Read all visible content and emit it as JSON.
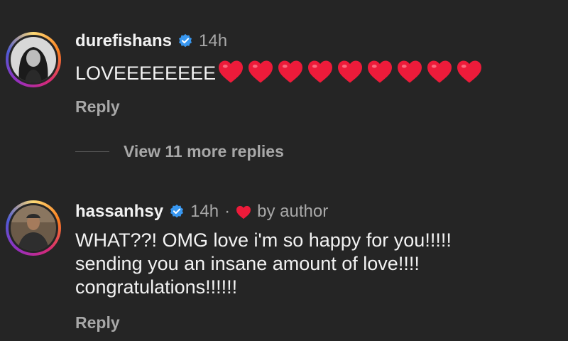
{
  "comments": [
    {
      "username": "durefishans",
      "time": "14h",
      "text": "LOVEEEEEEEE",
      "heart_count": 9,
      "reply_label": "Reply",
      "avatar_icon": "avatar-photo-woman"
    },
    {
      "username": "hassanhsy",
      "time": "14h",
      "dot": "·",
      "liked_by": "by author",
      "lines": [
        "WHAT??! OMG love i'm so happy for you!!!!!",
        "sending you an insane amount of love!!!!",
        "congratulations!!!!!!"
      ],
      "reply_label": "Reply",
      "avatar_icon": "avatar-photo-man"
    }
  ],
  "view_more": {
    "label": "View 11 more replies"
  },
  "colors": {
    "background": "#252525",
    "primary_text": "#f2f2f2",
    "secondary_text": "#a8a8a8",
    "verified_blue": "#3897f0",
    "heart_red": "#ed1b3a"
  },
  "icons": [
    "verified-badge-icon",
    "heart-emoji-icon",
    "heart-liked-icon"
  ]
}
